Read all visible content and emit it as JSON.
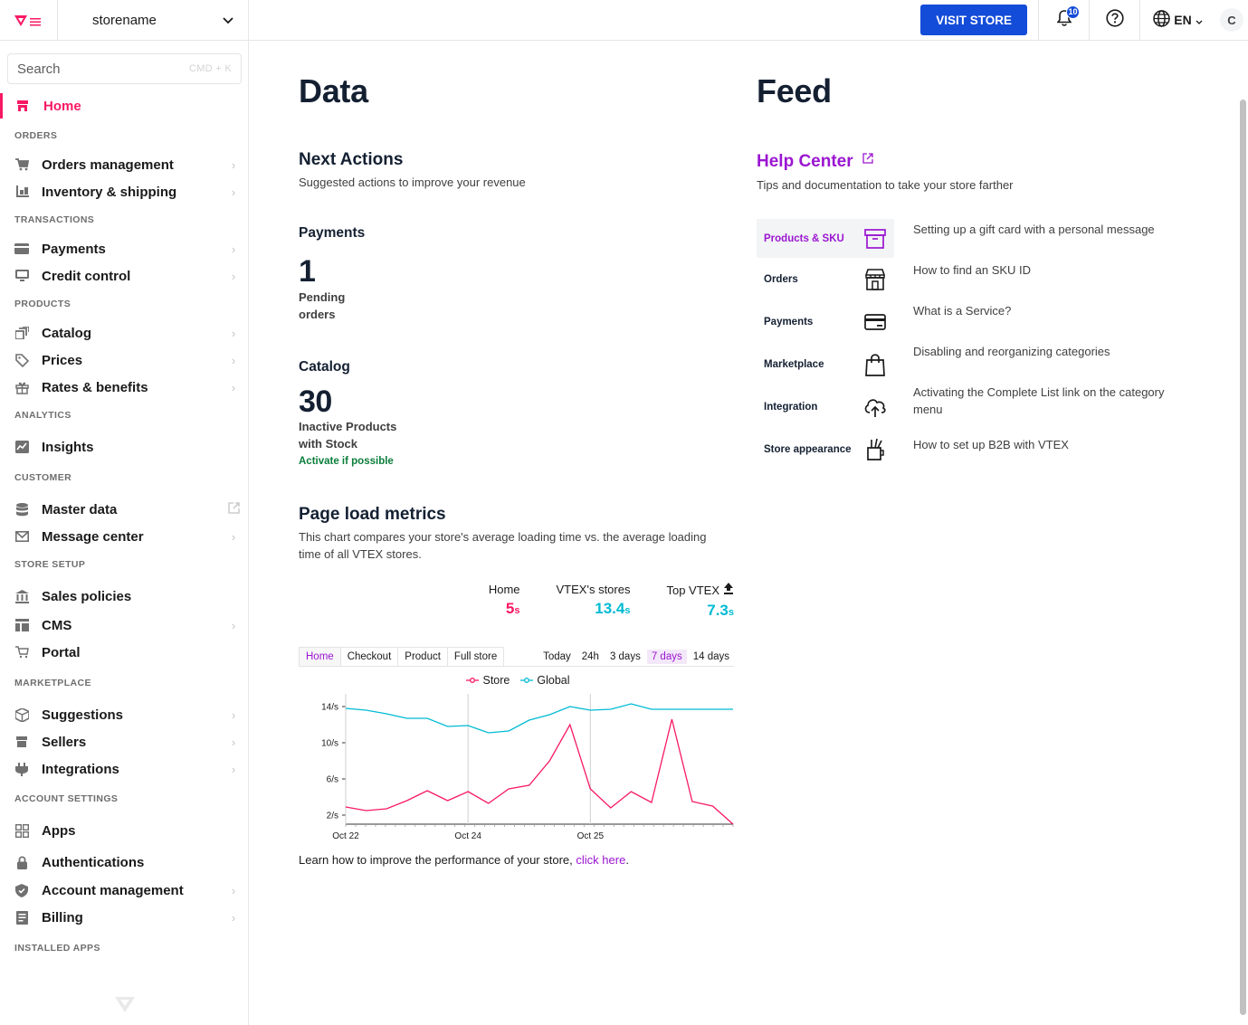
{
  "sidebar": {
    "store_name": "storename",
    "search_placeholder": "Search",
    "search_shortcut": "CMD + K",
    "home_label": "Home",
    "sections": {
      "orders": "ORDERS",
      "transactions": "TRANSACTIONS",
      "products": "PRODUCTS",
      "analytics": "ANALYTICS",
      "customer": "CUSTOMER",
      "store_setup": "STORE SETUP",
      "marketplace": "MARKETPLACE",
      "account_settings": "ACCOUNT SETTINGS",
      "installed_apps": "INSTALLED APPS"
    },
    "items": {
      "orders_management": "Orders management",
      "inventory_shipping": "Inventory & shipping",
      "payments": "Payments",
      "credit_control": "Credit control",
      "catalog": "Catalog",
      "prices": "Prices",
      "rates_benefits": "Rates & benefits",
      "insights": "Insights",
      "master_data": "Master data",
      "message_center": "Message center",
      "sales_policies": "Sales policies",
      "cms": "CMS",
      "portal": "Portal",
      "suggestions": "Suggestions",
      "sellers": "Sellers",
      "integrations": "Integrations",
      "apps": "Apps",
      "authentications": "Authentications",
      "account_management": "Account management",
      "billing": "Billing"
    }
  },
  "topbar": {
    "visit_store": "VISIT STORE",
    "notification_count": "10",
    "language": "EN",
    "avatar_initial": "C"
  },
  "data": {
    "title": "Data",
    "next_actions": {
      "title": "Next Actions",
      "subtitle": "Suggested actions to improve your revenue"
    },
    "payments": {
      "title": "Payments",
      "value": "1",
      "label_line1": "Pending",
      "label_line2": "orders"
    },
    "catalog": {
      "title": "Catalog",
      "value": "30",
      "label_line1": "Inactive Products",
      "label_line2": "with Stock",
      "action": "Activate if possible"
    },
    "page_load": {
      "title": "Page load metrics",
      "subtitle_line1": "This chart compares your store's average loading time vs. the average loading",
      "subtitle_line2": "time of all VTEX stores.",
      "metrics": [
        {
          "label": "Home",
          "value": "5",
          "unit": "s",
          "color": "#f71963"
        },
        {
          "label": "VTEX's stores",
          "value": "13.4",
          "unit": "s",
          "color": "#00bbd4"
        },
        {
          "label": "Top VTEX",
          "value": "7.3",
          "unit": "s",
          "color": "#00bbd4"
        }
      ],
      "tabs": [
        "Home",
        "Checkout",
        "Product",
        "Full store"
      ],
      "active_tab": "Home",
      "ranges": [
        "Today",
        "24h",
        "3 days",
        "7 days",
        "14 days"
      ],
      "active_range": "7 days",
      "learn_text": "Learn how to improve the performance of your store, ",
      "learn_link": "click here",
      "learn_end": "."
    }
  },
  "chart_data": {
    "type": "line",
    "y_ticks": [
      "14/s",
      "10/s",
      "6/s",
      "2/s"
    ],
    "x_ticks": [
      "Oct 22",
      "Oct 24",
      "Oct 25"
    ],
    "ylim": [
      1,
      15
    ],
    "colors": {
      "Store": "#f71963",
      "Global": "#00bbd4"
    },
    "series": [
      {
        "name": "Store",
        "values": [
          2.9,
          2.5,
          2.7,
          3.6,
          4.7,
          3.6,
          4.6,
          3.3,
          4.9,
          5.3,
          8.0,
          12.0,
          4.9,
          2.8,
          4.6,
          3.4,
          12.6,
          3.5,
          3.0,
          1.0
        ]
      },
      {
        "name": "Global",
        "values": [
          13.8,
          13.6,
          13.2,
          12.7,
          12.7,
          11.8,
          11.9,
          11.1,
          11.3,
          12.5,
          13.1,
          14.0,
          13.6,
          13.7,
          14.3,
          13.7,
          13.7,
          13.7,
          13.7,
          13.7
        ]
      }
    ]
  },
  "feed": {
    "title": "Feed",
    "help_center": {
      "title": "Help Center",
      "subtitle": "Tips and documentation to take your store farther",
      "categories": [
        "Products & SKU",
        "Orders",
        "Payments",
        "Marketplace",
        "Integration",
        "Store appearance"
      ],
      "articles": [
        "Setting up a gift card with a personal message",
        "How to find an SKU ID",
        "What is a Service?",
        "Disabling and reorganizing categories",
        "Activating the Complete List link on the category menu",
        "How to set up B2B with VTEX"
      ]
    }
  }
}
